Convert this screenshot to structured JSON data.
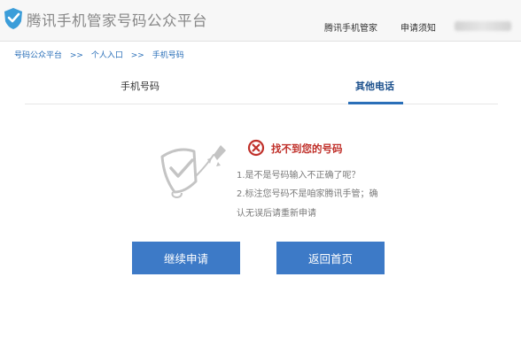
{
  "header": {
    "logo_icon": "shield-logo-icon",
    "title": "腾讯手机管家号码公众平台",
    "nav": {
      "guardian": "腾讯手机管家",
      "notice": "申请须知"
    }
  },
  "breadcrumb": {
    "items": [
      "号码公众平台",
      "个人入口",
      "手机号码"
    ],
    "separator": ">>"
  },
  "tabs": [
    {
      "label": "手机号码",
      "active": false
    },
    {
      "label": "其他电话",
      "active": true
    }
  ],
  "result": {
    "illustration": "shield-rocket-illustration",
    "error_icon": "x-circle-icon",
    "error_title": "找不到您的号码",
    "tips": [
      "1.是不是号码输入不正确了呢？",
      "2.标注您号码不是咱家腾讯手管；确",
      "认无误后请重新申请"
    ]
  },
  "buttons": {
    "continue": "继续申请",
    "home": "返回首页"
  },
  "colors": {
    "accent": "#3d7ac7",
    "error": "#c0302a",
    "link": "#2a6fb8"
  }
}
